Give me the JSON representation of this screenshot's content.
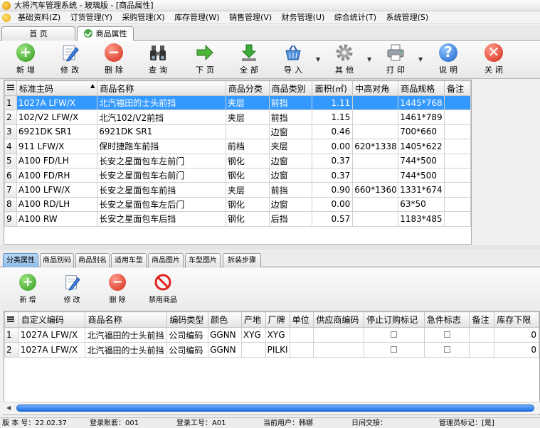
{
  "window": {
    "title": "大将汽车管理系统 - 玻璃版 - [商品属性]"
  },
  "menu": [
    "基础资料(Z)",
    "订货管理(Y)",
    "采购管理(X)",
    "库存管理(W)",
    "销售管理(V)",
    "财务管理(U)",
    "综合统计(T)",
    "系统管理(S)"
  ],
  "tabs": [
    {
      "label": "首 页"
    },
    {
      "label": "商品属性"
    }
  ],
  "toolbar": {
    "add": "新增",
    "edit": "修改",
    "delete": "删除",
    "query": "查询",
    "next": "下页",
    "all": "全部",
    "import": "导入",
    "other": "其他",
    "print": "打印",
    "help": "说明",
    "close": "关闭"
  },
  "product_grid": {
    "columns": [
      "标准主码",
      "商品名称",
      "商品分类",
      "商品类别",
      "面积(㎡)",
      "中高对角",
      "商品规格",
      "备注"
    ],
    "rows": [
      {
        "n": "1",
        "code": "1027A LFW/X",
        "name": "北汽福田的士头前挡",
        "cat": "夹层",
        "kind": "前挡",
        "area": "1.11",
        "diag": "",
        "spec": "1445*768",
        "note": ""
      },
      {
        "n": "2",
        "code": "102/V2 LFW/X",
        "name": "北汽102/V2前挡",
        "cat": "夹层",
        "kind": "前挡",
        "area": "1.15",
        "diag": "",
        "spec": "1461*789",
        "note": ""
      },
      {
        "n": "3",
        "code": "6921DK SR1",
        "name": "6921DK SR1",
        "cat": "",
        "kind": "边窗",
        "area": "0.46",
        "diag": "",
        "spec": "700*660",
        "note": ""
      },
      {
        "n": "4",
        "code": "911 LFW/X",
        "name": "保时捷跑车前挡",
        "cat": "前档",
        "kind": "夹层",
        "area": "0.00",
        "diag": "620*1338",
        "spec": "1405*622",
        "note": ""
      },
      {
        "n": "5",
        "code": "A100 FD/LH",
        "name": "长安之星面包车左前门",
        "cat": "钢化",
        "kind": "边窗",
        "area": "0.37",
        "diag": "",
        "spec": "744*500",
        "note": ""
      },
      {
        "n": "6",
        "code": "A100 FD/RH",
        "name": "长安之星面包车右前门",
        "cat": "钢化",
        "kind": "边窗",
        "area": "0.37",
        "diag": "",
        "spec": "744*500",
        "note": ""
      },
      {
        "n": "7",
        "code": "A100 LFW/X",
        "name": "长安之星面包车前挡",
        "cat": "夹层",
        "kind": "前挡",
        "area": "0.90",
        "diag": "660*1360",
        "spec": "1331*674",
        "note": ""
      },
      {
        "n": "8",
        "code": "A100 RD/LH",
        "name": "长安之星面包车左后门",
        "cat": "钢化",
        "kind": "边窗",
        "area": "0.00",
        "diag": "",
        "spec": "63*50",
        "note": ""
      },
      {
        "n": "9",
        "code": "A100 RW",
        "name": "长安之星面包车后挡",
        "cat": "钢化",
        "kind": "后挡",
        "area": "0.57",
        "diag": "",
        "spec": "1183*485",
        "note": ""
      }
    ]
  },
  "subtabs": [
    "分类属性",
    "商品别码",
    "商品别名",
    "适用车型",
    "商品图片",
    "车型图片",
    "拆装步骤"
  ],
  "subtoolbar": {
    "add": "新增",
    "edit": "修改",
    "delete": "删除",
    "forbid": "禁用商品"
  },
  "attr_grid": {
    "columns": [
      "自定义编码",
      "商品名称",
      "编码类型",
      "颜色",
      "产地",
      "厂牌",
      "单位",
      "供应商编码",
      "停止订购标记",
      "急件标志",
      "备注",
      "库存下限"
    ],
    "rows": [
      {
        "n": "1",
        "code": "1027A LFW/X",
        "name": "北汽福田的士头前挡",
        "type": "公司编码",
        "color": "GGNN",
        "origin": "XYG",
        "brand": "XYG",
        "unit": "",
        "supplier": "",
        "low": "0"
      },
      {
        "n": "2",
        "code": "1027A LFW/X",
        "name": "北汽福田的士头前挡",
        "type": "公司编码",
        "color": "GGNN",
        "origin": "",
        "brand": "PILKI",
        "unit": "",
        "supplier": "",
        "low": "0"
      }
    ]
  },
  "status": {
    "version": "版 本 号：22.02.37",
    "account": "登录账套：001",
    "user": "登录工号：A01",
    "current_user": "当前用户：韩娜",
    "date": "日间交接：",
    "flag": "管理员标记：[是]"
  },
  "colors": {
    "selection": "#3399ff",
    "scroll_thumb": "#1e6fe0",
    "subtab_active": "#8dbbe8"
  }
}
